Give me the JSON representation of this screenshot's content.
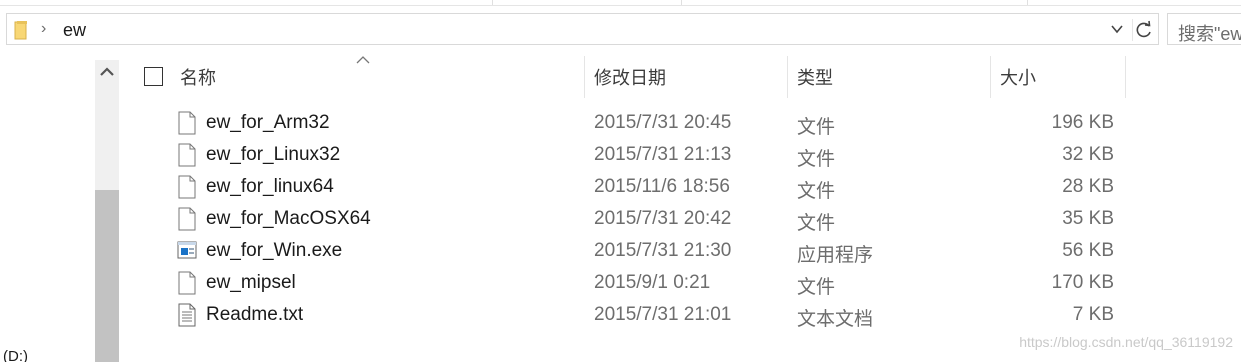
{
  "address": {
    "breadcrumb": "ew",
    "search_placeholder": "搜索\"ew"
  },
  "columns": {
    "name": "名称",
    "date_modified": "修改日期",
    "type": "类型",
    "size": "大小"
  },
  "files": [
    {
      "name": "ew_for_Arm32",
      "date": "2015/7/31 20:45",
      "type": "文件",
      "size": "196 KB",
      "icon": "blank-file-icon"
    },
    {
      "name": "ew_for_Linux32",
      "date": "2015/7/31 21:13",
      "type": "文件",
      "size": "32 KB",
      "icon": "blank-file-icon"
    },
    {
      "name": "ew_for_linux64",
      "date": "2015/11/6 18:56",
      "type": "文件",
      "size": "28 KB",
      "icon": "blank-file-icon"
    },
    {
      "name": "ew_for_MacOSX64",
      "date": "2015/7/31 20:42",
      "type": "文件",
      "size": "35 KB",
      "icon": "blank-file-icon"
    },
    {
      "name": "ew_for_Win.exe",
      "date": "2015/7/31 21:30",
      "type": "应用程序",
      "size": "56 KB",
      "icon": "exe-app-icon"
    },
    {
      "name": "ew_mipsel",
      "date": "2015/9/1 0:21",
      "type": "文件",
      "size": "170 KB",
      "icon": "blank-file-icon"
    },
    {
      "name": "Readme.txt",
      "date": "2015/7/31 21:01",
      "type": "文本文档",
      "size": "7 KB",
      "icon": "text-document-icon"
    }
  ],
  "nav_pane": {
    "partial_label": "(D:)"
  },
  "watermark": "https://blog.csdn.net/qq_36119192",
  "colors": {
    "folder_yellow": "#f8d775",
    "exe_blue": "#1a73c7"
  }
}
